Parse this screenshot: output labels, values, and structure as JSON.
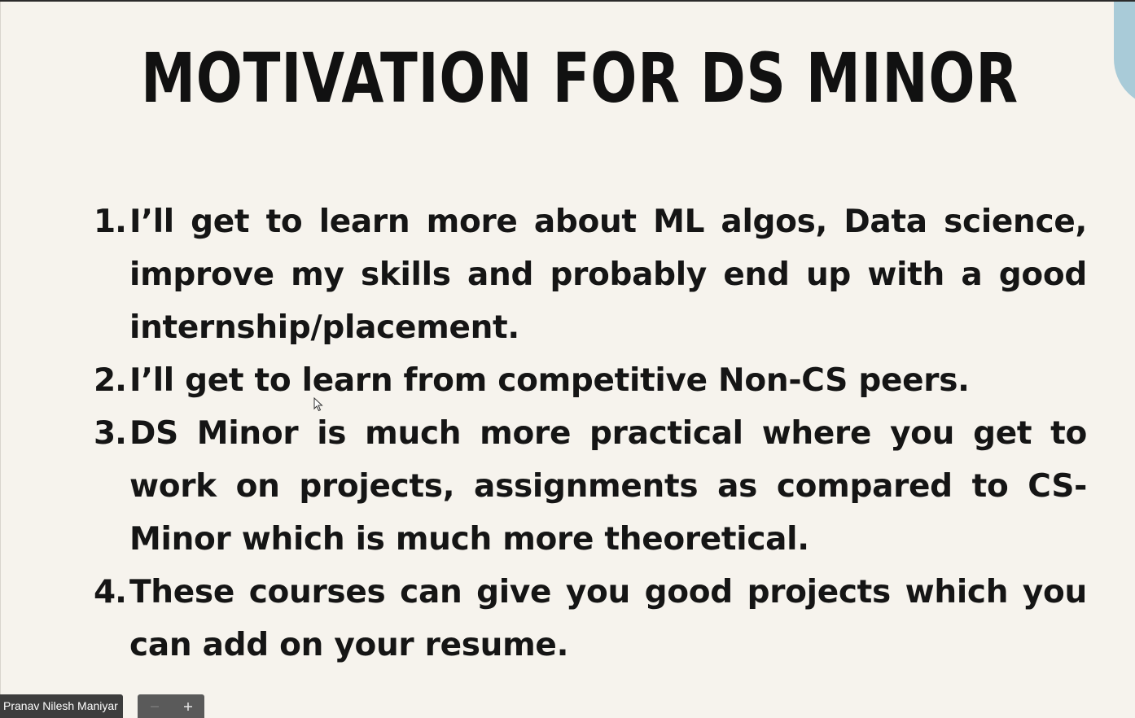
{
  "slide": {
    "title": "MOTIVATION FOR DS MINOR",
    "accent_color": "#a9cbd8",
    "background_color": "#f6f3ed",
    "items": [
      {
        "number": "1.",
        "text": "I’ll get to learn more about ML algos, Data science, improve my skills and probably end up with a good internship/placement."
      },
      {
        "number": "2.",
        "text": "I’ll get to learn from competitive Non-CS peers."
      },
      {
        "number": "3.",
        "text": "DS Minor is much more practical where you get to work on projects, assignments as compared to CS-Minor which is much more theoretical."
      },
      {
        "number": "4.",
        "text": "These courses can give you good projects which you can add on your resume."
      }
    ]
  },
  "presenter": {
    "name": "Pranav Nilesh Maniyar"
  },
  "zoom": {
    "out_icon": "minus-icon",
    "in_icon": "plus-icon"
  },
  "cursor": {
    "icon": "mouse-pointer-icon"
  }
}
